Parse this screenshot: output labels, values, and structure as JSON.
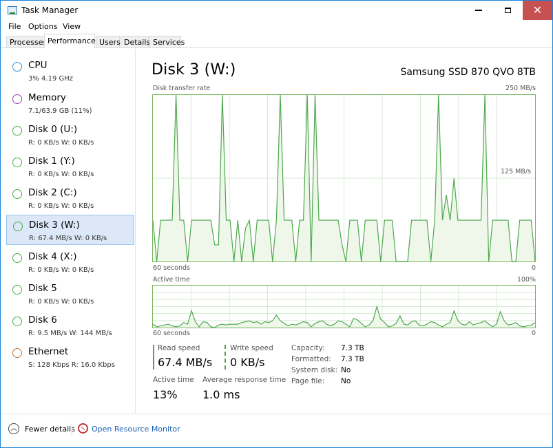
{
  "window": {
    "title": "Task Manager"
  },
  "menu": [
    "File",
    "Options",
    "View"
  ],
  "tabs": [
    {
      "label": "Processes",
      "active": false
    },
    {
      "label": "Performance",
      "active": true
    },
    {
      "label": "Users",
      "active": false
    },
    {
      "label": "Details",
      "active": false
    },
    {
      "label": "Services",
      "active": false
    }
  ],
  "colors": {
    "cpu": "#2a8fd8",
    "memory": "#9b3fb5",
    "disk": "#4da84d",
    "ethernet": "#c4703a",
    "selected_bg": "#dce8f8",
    "close_btn": "#c75050"
  },
  "sidebar": {
    "items": [
      {
        "title": "CPU",
        "sub": "3%  4.19 GHz",
        "color": "cpu"
      },
      {
        "title": "Memory",
        "sub": "7.1/63.9 GB (11%)",
        "color": "memory"
      },
      {
        "title": "Disk 0 (U:)",
        "sub": "R: 0 KB/s  W: 0 KB/s",
        "color": "disk"
      },
      {
        "title": "Disk 1 (Y:)",
        "sub": "R: 0 KB/s  W: 0 KB/s",
        "color": "disk"
      },
      {
        "title": "Disk 2 (C:)",
        "sub": "R: 0 KB/s  W: 0 KB/s",
        "color": "disk"
      },
      {
        "title": "Disk 3 (W:)",
        "sub": "R: 67.4 MB/s  W: 0 KB/s",
        "color": "disk",
        "selected": true
      },
      {
        "title": "Disk 4 (X:)",
        "sub": "R: 0 KB/s  W: 0 KB/s",
        "color": "disk"
      },
      {
        "title": "Disk 5",
        "sub": "R: 0 KB/s  W: 0 KB/s",
        "color": "disk"
      },
      {
        "title": "Disk 6",
        "sub": "R: 9.5 MB/s  W: 144 MB/s",
        "color": "disk"
      },
      {
        "title": "Ethernet",
        "sub": "S: 128 Kbps  R: 16.0 Kbps",
        "color": "ethernet"
      }
    ]
  },
  "main": {
    "title": "Disk 3 (W:)",
    "model": "Samsung SSD 870 QVO 8TB",
    "transfer_graph": {
      "label": "Disk transfer rate",
      "max_label": "250 MB/s",
      "mid_label": "125 MB/s",
      "time_label": "60 seconds",
      "min_label": "0",
      "max_value": 250,
      "values": [
        62,
        0,
        62,
        62,
        62,
        62,
        250,
        62,
        62,
        0,
        62,
        62,
        62,
        62,
        62,
        62,
        25,
        25,
        250,
        62,
        62,
        0,
        62,
        0,
        50,
        62,
        0,
        62,
        62,
        62,
        62,
        0,
        62,
        250,
        62,
        62,
        62,
        0,
        62,
        62,
        250,
        0,
        250,
        62,
        62,
        62,
        62,
        62,
        62,
        25,
        0,
        62,
        62,
        62,
        0,
        62,
        62,
        62,
        62,
        0,
        62,
        62,
        62,
        0,
        0,
        0,
        0,
        62,
        62,
        62,
        62,
        62,
        0,
        62,
        250,
        62,
        100,
        62,
        125,
        62,
        62,
        62,
        62,
        62,
        62,
        62,
        250,
        0,
        62,
        62,
        62,
        62,
        62,
        0,
        0,
        62,
        62,
        62,
        62,
        0
      ]
    },
    "active_graph": {
      "label": "Active time",
      "max_label": "100%",
      "time_label": "60 seconds",
      "min_label": "0",
      "max_value": 100,
      "values": [
        8,
        2,
        4,
        6,
        8,
        4,
        2,
        4,
        12,
        8,
        40,
        14,
        2,
        14,
        12,
        2,
        0,
        6,
        8,
        6,
        8,
        8,
        8,
        12,
        14,
        16,
        12,
        14,
        8,
        14,
        12,
        16,
        30,
        16,
        10,
        4,
        8,
        6,
        10,
        14,
        12,
        2,
        10,
        14,
        16,
        8,
        4,
        8,
        16,
        14,
        8,
        2,
        22,
        18,
        10,
        2,
        6,
        16,
        50,
        20,
        12,
        2,
        4,
        10,
        28,
        8,
        6,
        14,
        16,
        6,
        4,
        8,
        14,
        12,
        6,
        2,
        8,
        12,
        40,
        16,
        8,
        6,
        14,
        6,
        10,
        12,
        16,
        8,
        2,
        8,
        38,
        16,
        6,
        8,
        12,
        4,
        2,
        4,
        6,
        12
      ]
    },
    "stats": {
      "read_speed_label": "Read speed",
      "read_speed": "67.4 MB/s",
      "write_speed_label": "Write speed",
      "write_speed": "0 KB/s",
      "active_time_label": "Active time",
      "active_time": "13%",
      "response_label": "Average response time",
      "response": "1.0 ms"
    },
    "properties": [
      {
        "label": "Capacity:",
        "value": "7.3 TB"
      },
      {
        "label": "Formatted:",
        "value": "7.3 TB"
      },
      {
        "label": "System disk:",
        "value": "No"
      },
      {
        "label": "Page file:",
        "value": "No"
      }
    ]
  },
  "footer": {
    "fewer_details": "Fewer details",
    "resource_monitor": "Open Resource Monitor"
  }
}
